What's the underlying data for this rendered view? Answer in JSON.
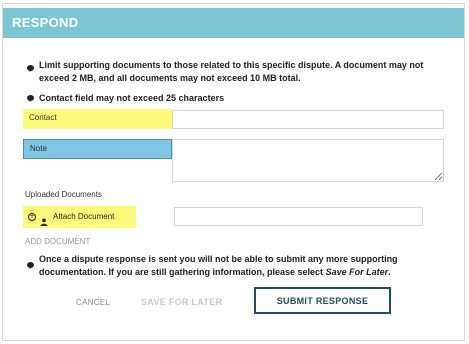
{
  "dialog": {
    "title": "RESPOND",
    "notes": [
      "Limit supporting documents to those related to this specific dispute. A document may not exceed 2 MB, and all documents may not exceed 10 MB total.",
      "Contact field may not exceed 25 characters"
    ],
    "contact": {
      "label": "Contact",
      "value": "",
      "placeholder": ""
    },
    "note_field": {
      "label": "Note",
      "value": "",
      "placeholder": ""
    },
    "uploaded_documents_label": "Uploaded Documents",
    "attach_document_label": "Attach Document",
    "add_document_label": "ADD DOCUMENT",
    "warning_prefix": "Once a dispute response is sent you will not be able to submit any more supporting documentation. If you are still gathering information, please select",
    "warning_emphasis": "Save For Later",
    "warning_suffix": ".",
    "buttons": {
      "cancel": "CANCEL",
      "save_for_later": "SAVE FOR LATER",
      "submit": "SUBMIT RESPONSE"
    },
    "colors": {
      "header": "#7cc6d4",
      "highlight_yellow": "#fdfb7a",
      "highlight_blue": "#7ec6e3",
      "primary_border": "#1f4f5f"
    }
  }
}
